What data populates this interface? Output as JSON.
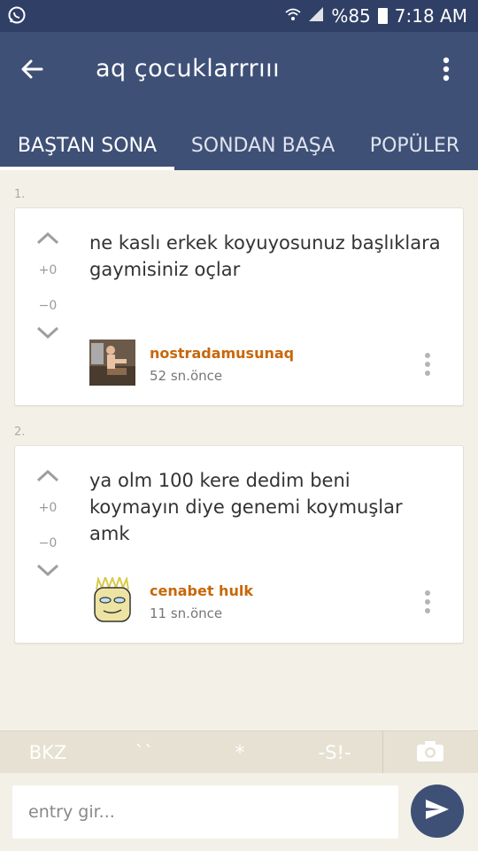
{
  "status_bar": {
    "battery_percent": "%85",
    "time": "7:18 AM",
    "icons": [
      "whatsapp-icon",
      "wifi-icon",
      "signal-icon",
      "battery-icon"
    ]
  },
  "toolbar": {
    "title": "aq çocuklarrrııı"
  },
  "tabs": [
    {
      "label": "BAŞTAN SONA",
      "active": true
    },
    {
      "label": "SONDAN BAŞA",
      "active": false
    },
    {
      "label": "POPÜLER",
      "active": false
    }
  ],
  "entries": [
    {
      "index": "1.",
      "score_plus": "+0",
      "score_minus": "−0",
      "text": "ne kaslı erkek koyuyosunuz başlıklara gaymisiniz oçlar",
      "author": "nostradamusunaq",
      "time": "52 sn.önce"
    },
    {
      "index": "2.",
      "score_plus": "+0",
      "score_minus": "−0",
      "text": "ya olm 100 kere dedim beni koymayın diye genemi koymuşlar amk",
      "author": "cenabet hulk",
      "time": "11 sn.önce"
    }
  ],
  "format_bar": {
    "bkz": "BKZ",
    "backtick": "``",
    "asterisk": "*",
    "spoiler": "-S!-"
  },
  "input": {
    "placeholder": "entry gir..."
  },
  "colors": {
    "header": "#3f5077",
    "status_bar": "#2f3f66",
    "background": "#f3f0e7",
    "author": "#c8670a"
  }
}
